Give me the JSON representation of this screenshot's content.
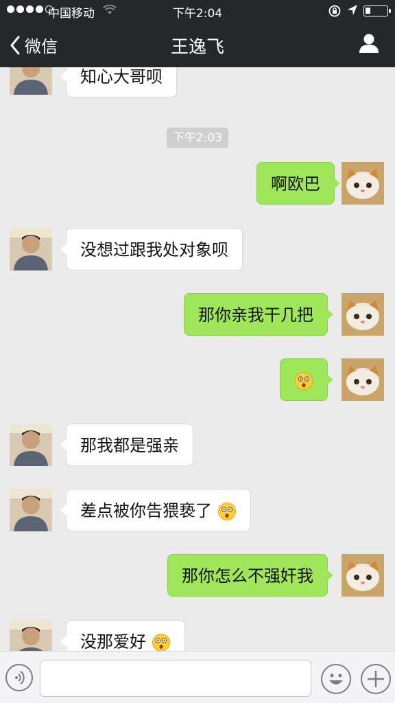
{
  "status": {
    "carrier": "中国移动",
    "time": "下午2:04"
  },
  "nav": {
    "back_label": "微信",
    "title": "王逸飞"
  },
  "timestamp": "下午2:03",
  "messages": [
    {
      "from": "contact",
      "text": "知心大哥呗"
    },
    {
      "from": "me",
      "text": "啊欧巴"
    },
    {
      "from": "contact",
      "text": "没想过跟我处对象呗"
    },
    {
      "from": "me",
      "text": "那你亲我干几把"
    },
    {
      "from": "me",
      "text": "",
      "emoji": "dizzy-face-emoji"
    },
    {
      "from": "contact",
      "text": "那我都是强亲"
    },
    {
      "from": "contact",
      "text": "差点被你告猥亵了",
      "emoji": "dizzy-face-emoji"
    },
    {
      "from": "me",
      "text": "那你怎么不强奸我"
    },
    {
      "from": "contact",
      "text": "没那爱好",
      "emoji": "dizzy-face-emoji"
    }
  ],
  "colors": {
    "nav_bg": "#26272b",
    "sent_bubble": "#9fe65a",
    "received_bubble": "#ffffff",
    "chat_bg": "#ebebeb"
  },
  "icons": {
    "voice": "voice-icon",
    "emoji": "smiley-icon",
    "more": "plus-icon",
    "profile": "person-icon"
  }
}
